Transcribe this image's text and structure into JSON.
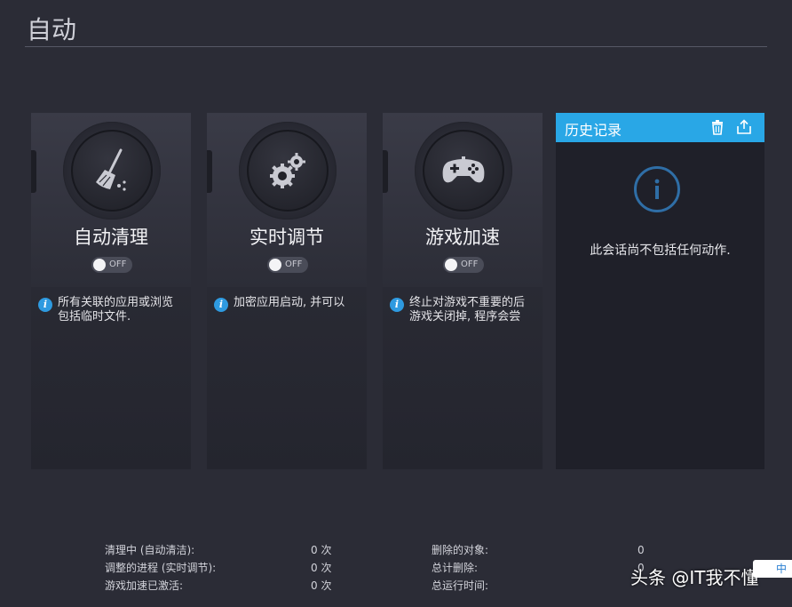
{
  "page": {
    "title": "自动"
  },
  "cards": [
    {
      "name": "自动清理",
      "toggle": "OFF",
      "desc_lines": [
        "所有关联的应用或浏览",
        "包括临时文件."
      ],
      "icon": "broom-icon"
    },
    {
      "name": "实时调节",
      "toggle": "OFF",
      "desc_lines": [
        "加密应用启动, 并可以"
      ],
      "icon": "gears-icon"
    },
    {
      "name": "游戏加速",
      "toggle": "OFF",
      "desc_lines": [
        "终止对游戏不重要的后",
        "游戏关闭掉, 程序会尝"
      ],
      "icon": "gamepad-icon"
    }
  ],
  "history": {
    "title": "历史记录",
    "empty_text": "此会话尚不包括任何动作.",
    "actions": [
      "trash-icon",
      "share-icon"
    ]
  },
  "stats_left": [
    {
      "label": "清理中 (自动清洁):",
      "value": "0 次"
    },
    {
      "label": "调整的进程 (实时调节):",
      "value": "0 次"
    },
    {
      "label": "游戏加速已激活:",
      "value": "0 次"
    }
  ],
  "stats_right": [
    {
      "label": "删除的对象:",
      "value": "0"
    },
    {
      "label": "总计删除:",
      "value": "0"
    },
    {
      "label": "总运行时间:",
      "value": ""
    }
  ],
  "watermark": {
    "text": "头条 @IT我不懂",
    "badge": "中"
  },
  "colors": {
    "accent": "#29a7e6",
    "background": "#2b2c36",
    "info": "#2e9ae0"
  }
}
